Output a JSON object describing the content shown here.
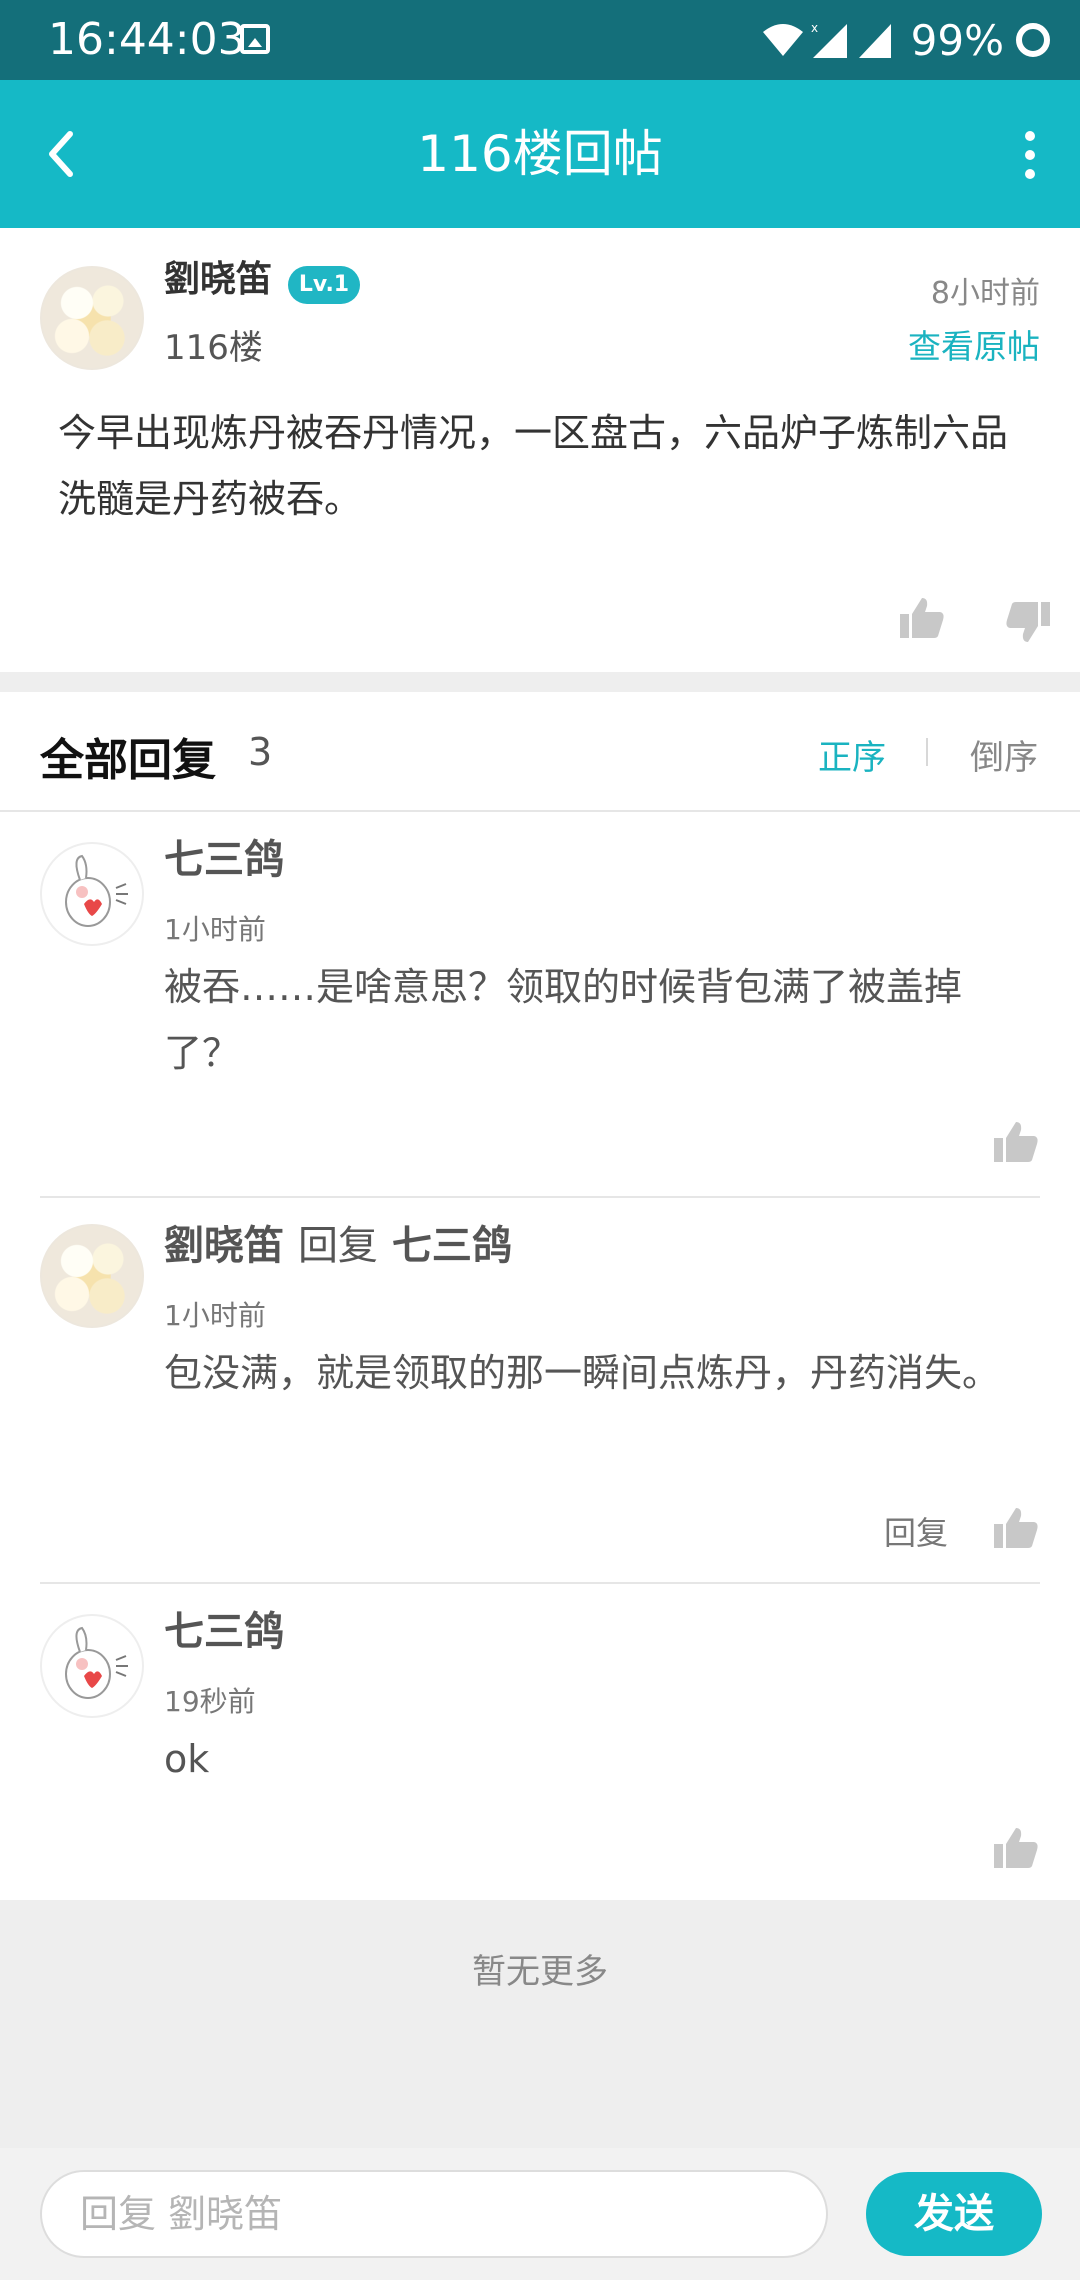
{
  "status_bar": {
    "time": "16:44:03",
    "battery": "99%",
    "icons": [
      "image-icon",
      "wifi-icon",
      "signal-x-icon",
      "signal-icon",
      "battery-ring-icon"
    ]
  },
  "app_bar": {
    "title": "116楼回帖",
    "back_icon": "chevron-left-icon",
    "more_icon": "more-vertical-icon"
  },
  "post": {
    "author": "劉晓笛",
    "level": "Lv.1",
    "floor": "116楼",
    "time": "8小时前",
    "view_original": "查看原帖",
    "text": "今早出现炼丹被吞丹情况，一区盘古，六品炉子炼制六品洗髓是丹药被吞。"
  },
  "replies_header": {
    "title": "全部回复",
    "count": "3",
    "sort_asc": "正序",
    "sort_desc": "倒序"
  },
  "replies": [
    {
      "author": "七三鸽",
      "time": "1小时前",
      "text": "被吞……是啥意思？领取的时候背包满了被盖掉了？"
    },
    {
      "author": "劉晓笛",
      "reply_word": "回复",
      "reply_to": "七三鸽",
      "time": "1小时前",
      "text": "包没满，就是领取的那一瞬间点炼丹，丹药消失。",
      "reply_button": "回复"
    },
    {
      "author": "七三鸽",
      "time": "19秒前",
      "text": "ok"
    }
  ],
  "footer": {
    "no_more": "暂无更多"
  },
  "input_bar": {
    "placeholder": "回复 劉晓笛",
    "send_label": "发送"
  },
  "colors": {
    "status_bar": "#146f7a",
    "app_bar": "#15b9c6",
    "accent": "#1ab3c0"
  }
}
